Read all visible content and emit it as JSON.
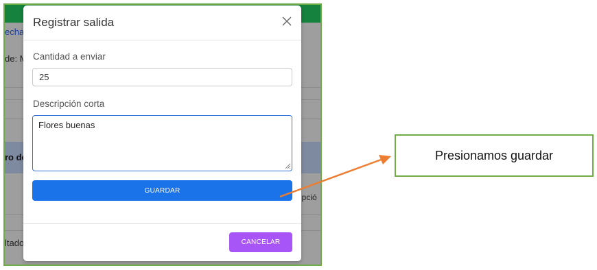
{
  "background": {
    "fragments": {
      "fecha": "echa",
      "de": "de: M",
      "registro": "ro de",
      "descripcion": "ripció",
      "resultados": "ltado"
    }
  },
  "modal": {
    "title": "Registrar salida",
    "quantity_label": "Cantidad a enviar",
    "quantity_value": "25",
    "description_label": "Descripción corta",
    "description_value": "Flores buenas",
    "save_label": "GUARDAR",
    "cancel_label": "CANCELAR"
  },
  "annotation": {
    "text": "Presionamos guardar"
  },
  "colors": {
    "topbar": "#15823d",
    "primary": "#1a73e8",
    "cancel": "#a855f7",
    "frame": "#70ad47",
    "arrow": "#ed7d31"
  },
  "icons": {
    "close": "close-icon",
    "arrow": "arrow-icon"
  }
}
